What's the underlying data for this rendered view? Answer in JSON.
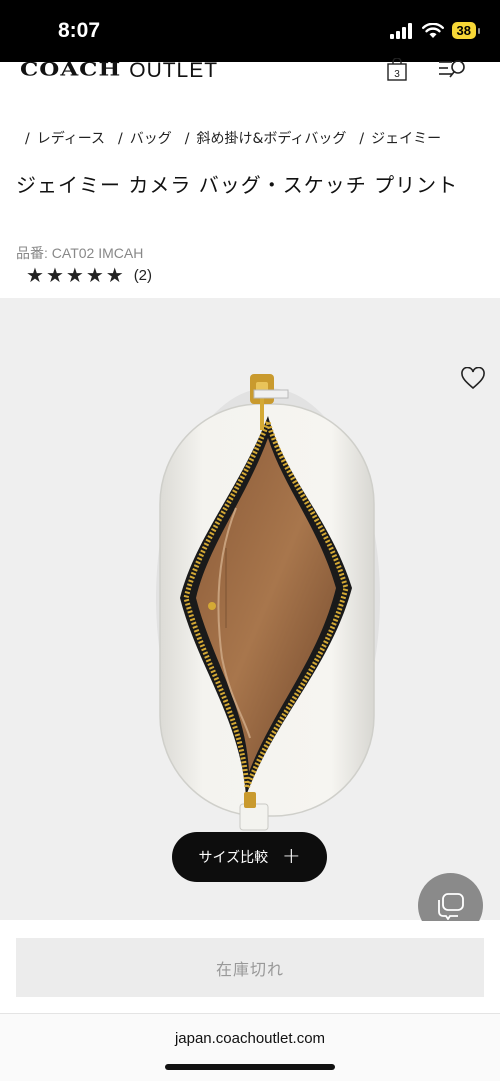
{
  "status_bar": {
    "time": "8:07",
    "battery": "38"
  },
  "header": {
    "brand_name": "COACH",
    "brand_suffix": "OUTLET",
    "cart_count": "3"
  },
  "breadcrumb": [
    "レディース",
    "バッグ",
    "斜め掛け&ボディバッグ",
    "ジェイミー"
  ],
  "product": {
    "title": "ジェイミー カメラ バッグ・スケッチ プリント",
    "sku_label": "品番: CAT02 IMCAH",
    "rating": 5,
    "rating_count": "(2)"
  },
  "gallery": {
    "size_compare_label": "サイズ比較"
  },
  "purchase": {
    "sold_out_label": "在庫切れ"
  },
  "browser": {
    "url": "japan.coachoutlet.com"
  }
}
